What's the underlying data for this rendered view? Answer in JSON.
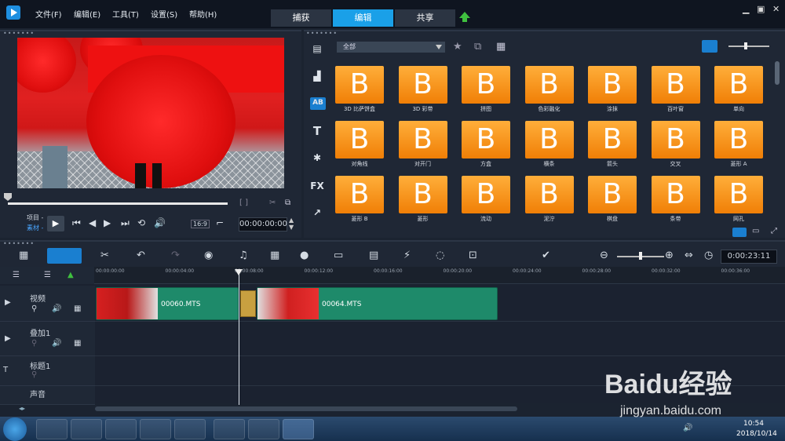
{
  "menu": [
    "文件(F)",
    "编辑(E)",
    "工具(T)",
    "设置(S)",
    "帮助(H)"
  ],
  "tabs": {
    "capture": "捕获",
    "edit": "编辑",
    "share": "共享"
  },
  "preview": {
    "project_label": "项目 -",
    "clip_label": "素材 -",
    "ratio": "16:9",
    "timecode": "00:00:00:00"
  },
  "library": {
    "filter": "全部",
    "items": [
      {
        "label": "3D 比萨饼盒"
      },
      {
        "label": "3D 彩带"
      },
      {
        "label": "拼图"
      },
      {
        "label": "色彩融化"
      },
      {
        "label": "涂抹"
      },
      {
        "label": "百叶窗"
      },
      {
        "label": "单向"
      },
      {
        "label": "对角线"
      },
      {
        "label": "对开门"
      },
      {
        "label": "方盒"
      },
      {
        "label": "横条"
      },
      {
        "label": "箭头"
      },
      {
        "label": "交叉"
      },
      {
        "label": "菱形 A"
      },
      {
        "label": "菱形 B"
      },
      {
        "label": "菱形"
      },
      {
        "label": "流动"
      },
      {
        "label": "泥泞"
      },
      {
        "label": "棋盘"
      },
      {
        "label": "条带"
      },
      {
        "label": "网孔"
      }
    ],
    "thumb_letter": "B"
  },
  "timeline": {
    "timecode": "0:00:23:11",
    "ruler": [
      "00:00:00:00",
      "00:00:04:00",
      "00:00:08:00",
      "00:00:12:00",
      "00:00:16:00",
      "00:00:20:00",
      "00:00:24:00",
      "00:00:28:00",
      "00:00:32:00",
      "00:00:36:00"
    ],
    "tracks": [
      {
        "name": "视频"
      },
      {
        "name": "叠加1"
      },
      {
        "name": "标题1"
      },
      {
        "name": "声音"
      }
    ],
    "clips": [
      {
        "name": "00060.MTS"
      },
      {
        "name": "00064.MTS"
      }
    ]
  },
  "taskbar": {
    "time": "10:54",
    "date": "2018/10/14"
  },
  "watermark": {
    "brand": "Baidu经验",
    "url": "jingyan.baidu.com"
  }
}
